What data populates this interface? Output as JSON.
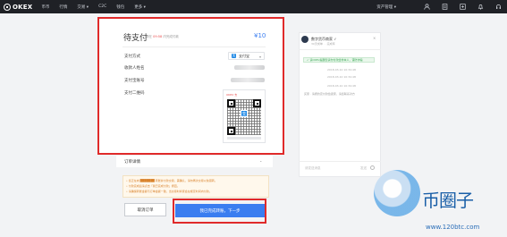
{
  "topbar": {
    "logo": "OKEX",
    "nav": [
      "币币",
      "行情",
      "交易 ▾",
      "C2C",
      "钱包",
      "更多 ▾"
    ],
    "asset_label": "资产管理 ▾",
    "icons": [
      "user-icon",
      "doc-icon",
      "plus-icon",
      "bell-icon",
      "headset-icon"
    ]
  },
  "payment": {
    "title": "待支付",
    "subtitle_prefix": "请在",
    "countdown": "09:58",
    "subtitle_suffix": "内完成付款",
    "amount": "¥10",
    "method_label": "支付方式",
    "method_value": "支付宝",
    "payee_label": "收款人姓名",
    "account_label": "支付宝账号",
    "qrcode_label": "支付二维码",
    "qr_header": "OKEX 支",
    "qr_center_glyph": "支"
  },
  "order": {
    "label": "订单详情",
    "chevron": "⌄"
  },
  "notices": [
    "• 您正在向 ███████ 转账并付款交易，需确认，请勿再次交易以免错转。",
    "• 付款完成后请点击「我已完成付款」按钮。",
    "• 请确保转账金额与订单金额一致，当交易时商家会在规定时间内付款。"
  ],
  "buttons": {
    "cancel": "取消订单",
    "confirm": "我已完成转账，下一步"
  },
  "chat": {
    "name": "数字货币商家 ✓",
    "sub": "30天成单 ·  · 完成率",
    "close": "×",
    "green_notice": "✓ 请OKEx提醒您请勿付款给非本人，谨防诈骗",
    "times": [
      "2018-03-10 10:34:48",
      "2018-03-10 10:34:48",
      "2018-03-10 10:34:48"
    ],
    "system_msg": "买家 · 请按约定付款给卖家，请您联系对方",
    "input_placeholder": "请发送消息",
    "send": "发送"
  },
  "watermark": {
    "text": "币圈子",
    "url": "www.120btc.com"
  }
}
